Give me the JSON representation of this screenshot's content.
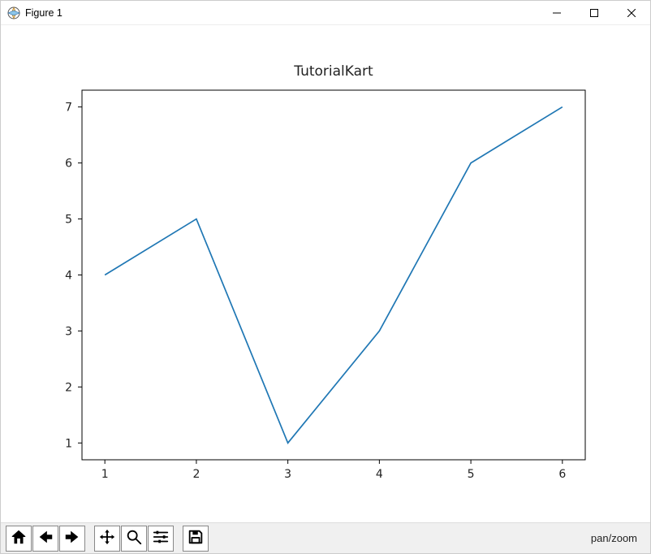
{
  "window": {
    "title": "Figure 1",
    "controls": {
      "minimize": "minimize",
      "maximize": "maximize",
      "close": "close"
    }
  },
  "chart_data": {
    "type": "line",
    "title": "TutorialKart",
    "x": [
      1,
      2,
      3,
      4,
      5,
      6
    ],
    "y": [
      4,
      5,
      1,
      3,
      6,
      7
    ],
    "xticks": [
      1,
      2,
      3,
      4,
      5,
      6
    ],
    "yticks": [
      1,
      2,
      3,
      4,
      5,
      6,
      7
    ],
    "xlim": [
      0.75,
      6.25
    ],
    "ylim": [
      0.7,
      7.3
    ],
    "xlabel": "",
    "ylabel": "",
    "grid": false,
    "line_color": "#1f77b4"
  },
  "toolbar": {
    "home": "Home",
    "back": "Back",
    "forward": "Forward",
    "pan": "Pan",
    "zoom": "Zoom",
    "configure": "Configure subplots",
    "save": "Save"
  },
  "status": "pan/zoom"
}
